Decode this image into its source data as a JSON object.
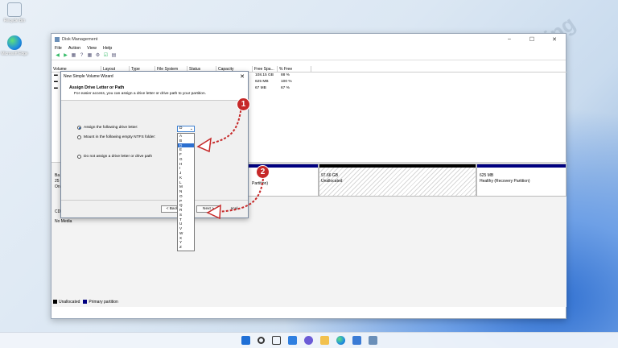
{
  "desktop": {
    "icons": [
      {
        "label": "Recycle Bin",
        "icon": "recycle-bin-icon"
      },
      {
        "label": "Microsoft Edge",
        "icon": "edge-icon"
      }
    ],
    "watermark": "itkoding"
  },
  "window": {
    "title": "Disk Management",
    "menu": [
      "File",
      "Action",
      "View",
      "Help"
    ],
    "columns": [
      "Volume",
      "Layout",
      "Type",
      "File System",
      "Status",
      "Capacity",
      "Free Spa...",
      "% Free"
    ],
    "volume_rows": [
      {
        "free": "108.15 GB",
        "pct": "88 %"
      },
      {
        "free": "625 MB",
        "pct": "100 %"
      },
      {
        "free": "67 MB",
        "pct": "67 %"
      }
    ],
    "disk0": {
      "label_lines": [
        "Ba",
        "25",
        "On"
      ],
      "partition_mid": "Partition)",
      "unallocated_size": "97.66 GB",
      "unallocated_label": "Unallocated",
      "recovery_size": "625 MB",
      "recovery_label": "Healthy (Recovery Partition)"
    },
    "cd": {
      "label": "CD",
      "media": "No Media"
    },
    "legend": [
      {
        "label": "Unallocated",
        "color": "#000000"
      },
      {
        "label": "Primary partition",
        "color": "#000080"
      }
    ]
  },
  "wizard": {
    "title": "New Simple Volume Wizard",
    "heading": "Assign Drive Letter or Path",
    "subheading": "For easier access, you can assign a drive letter or drive path to your partition.",
    "opt_assign": "Assign the following drive letter:",
    "opt_mount": "Mount in the following empty NTFS folder:",
    "opt_none": "Do not assign a drive letter or drive path",
    "back": "< Back",
    "next": "Next >",
    "cancel": "ncel",
    "selected_letter": "D",
    "letters": [
      "A",
      "B",
      "D",
      "E",
      "F",
      "G",
      "H",
      "I",
      "J",
      "K",
      "L",
      "M",
      "N",
      "O",
      "P",
      "Q",
      "R",
      "S",
      "T",
      "U",
      "V",
      "W",
      "X",
      "Y",
      "Z"
    ],
    "highlighted_letter": "D"
  },
  "callouts": [
    {
      "number": "1"
    },
    {
      "number": "2"
    }
  ],
  "accent": "#c62828"
}
